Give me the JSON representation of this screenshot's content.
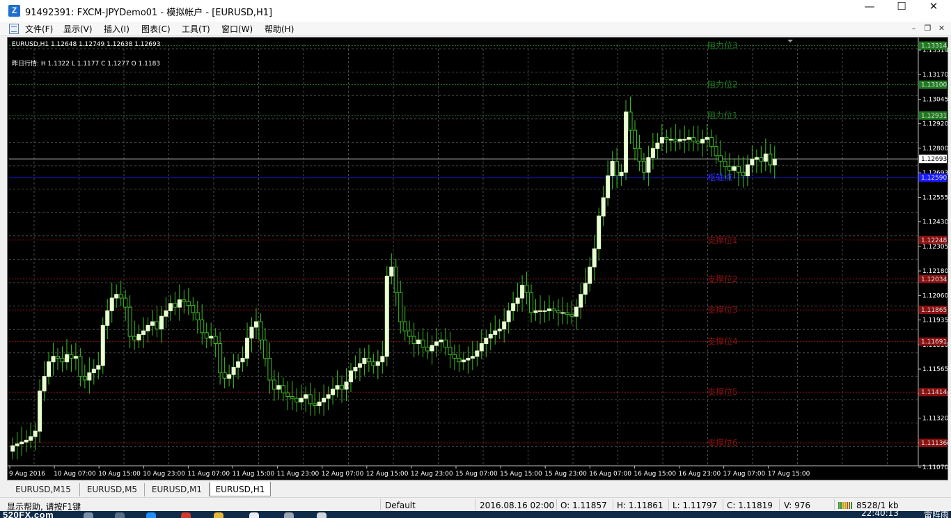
{
  "window": {
    "title": "91492391: FXCM-JPYDemo01 - 模拟帐户 - [EURUSD,H1]",
    "app_icon_letter": "Z",
    "min_glyph": "—",
    "max_glyph": "☐",
    "close_glyph": "✕"
  },
  "menu": {
    "items": [
      {
        "label": "文件(F)"
      },
      {
        "label": "显示(V)"
      },
      {
        "label": "插入(I)"
      },
      {
        "label": "图表(C)"
      },
      {
        "label": "工具(T)"
      },
      {
        "label": "窗口(W)"
      },
      {
        "label": "帮助(H)"
      }
    ],
    "mdi_min": "–",
    "mdi_restore": "❐",
    "mdi_close": "✕"
  },
  "chart": {
    "symbol_header": "EURUSD,H1  1.12648 1.12749 1.12638 1.12693",
    "yesterday_info": "昨日行情:  H 1.1322   L 1.1177   C 1.1277   O 1.1183",
    "colors": {
      "background": "#000000",
      "grid": "#4a4a4a",
      "bull_body": "#e8ffcf",
      "wick": "#3bbf1f",
      "resistance": "#1f7a1f",
      "support": "#8a1010",
      "pivot": "#1a1aff",
      "bid": "#c8c8c8"
    }
  },
  "chart_data": {
    "type": "candlestick",
    "symbol": "EURUSD",
    "timeframe": "H1",
    "ylim": [
      1.1101,
      1.1332
    ],
    "y_ticks": [
      1.1314,
      1.13,
      1.128,
      1.126,
      1.124,
      1.122,
      1.12,
      1.118,
      1.116,
      1.114,
      1.112,
      1.11
    ],
    "y_tick_labels": [
      "1.13314",
      "1.13170",
      "1.13045",
      "1.12920",
      "1.12800",
      "1.12693",
      "1.12555",
      "1.12430",
      "1.12305",
      "1.12180",
      "1.12060",
      "1.11935",
      "1.11810",
      "1.11565",
      "1.11440",
      "1.11320",
      "1.11195",
      "1.11070"
    ],
    "x_tick_labels": [
      "9 Aug 2016",
      "10 Aug 07:00",
      "10 Aug 15:00",
      "10 Aug 23:00",
      "11 Aug 07:00",
      "11 Aug 15:00",
      "11 Aug 23:00",
      "12 Aug 07:00",
      "12 Aug 15:00",
      "12 Aug 23:00",
      "15 Aug 07:00",
      "15 Aug 15:00",
      "15 Aug 23:00",
      "16 Aug 07:00",
      "16 Aug 15:00",
      "16 Aug 23:00",
      "17 Aug 07:00",
      "17 Aug 15:00"
    ],
    "current_price": 1.12693,
    "levels": [
      {
        "name": "阻力位3",
        "value": 1.13314,
        "kind": "resistance",
        "tag": "1.13314"
      },
      {
        "name": "阻力位2",
        "value": 1.131,
        "kind": "resistance",
        "tag": "1.13100"
      },
      {
        "name": "阻力位1",
        "value": 1.12931,
        "kind": "resistance",
        "tag": "1.12931"
      },
      {
        "name": "枢轴点",
        "value": 1.1259,
        "kind": "pivot",
        "tag": "1.12590"
      },
      {
        "name": "支撑位1",
        "value": 1.12248,
        "kind": "support",
        "tag": "1.12248"
      },
      {
        "name": "支撑位2",
        "value": 1.12034,
        "kind": "support",
        "tag": "1.12034"
      },
      {
        "name": "支撑位3",
        "value": 1.11865,
        "kind": "support",
        "tag": "1.11865"
      },
      {
        "name": "支撑位4",
        "value": 1.11691,
        "kind": "support",
        "tag": "1.11691"
      },
      {
        "name": "支撑位5",
        "value": 1.11414,
        "kind": "support",
        "tag": "1.11414"
      },
      {
        "name": "支撑位6",
        "value": 1.11136,
        "kind": "support",
        "tag": "1.11136"
      }
    ],
    "close_series": [
      1.1112,
      1.1113,
      1.1114,
      1.1115,
      1.1117,
      1.112,
      1.1142,
      1.115,
      1.1158,
      1.1161,
      1.116,
      1.1158,
      1.1162,
      1.116,
      1.1161,
      1.115,
      1.1148,
      1.1152,
      1.1154,
      1.1156,
      1.1178,
      1.1186,
      1.1193,
      1.1195,
      1.1193,
      1.1188,
      1.1172,
      1.117,
      1.1173,
      1.1175,
      1.1178,
      1.118,
      1.1176,
      1.1183,
      1.1186,
      1.119,
      1.1188,
      1.1192,
      1.1191,
      1.1189,
      1.1185,
      1.1181,
      1.1174,
      1.1171,
      1.1172,
      1.1168,
      1.1152,
      1.1149,
      1.1151,
      1.1155,
      1.1158,
      1.116,
      1.1171,
      1.1177,
      1.118,
      1.117,
      1.116,
      1.1148,
      1.1143,
      1.1145,
      1.1141,
      1.1139,
      1.1138,
      1.1136,
      1.1138,
      1.114,
      1.1135,
      1.1134,
      1.1136,
      1.1138,
      1.114,
      1.1143,
      1.1145,
      1.1143,
      1.1147,
      1.1153,
      1.1155,
      1.1157,
      1.116,
      1.1158,
      1.1156,
      1.1158,
      1.1161,
      1.1205,
      1.121,
      1.1196,
      1.118,
      1.1175,
      1.1172,
      1.1168,
      1.117,
      1.1166,
      1.1164,
      1.1167,
      1.1169,
      1.117,
      1.1166,
      1.1162,
      1.116,
      1.1158,
      1.1159,
      1.116,
      1.1161,
      1.1164,
      1.1168,
      1.1171,
      1.1173,
      1.1175,
      1.1176,
      1.118,
      1.1186,
      1.119,
      1.1193,
      1.12,
      1.1196,
      1.1185,
      1.1186,
      1.1186,
      1.1186,
      1.1187,
      1.1186,
      1.1185,
      1.1185,
      1.1184,
      1.1183,
      1.1188,
      1.1195,
      1.1201,
      1.121,
      1.122,
      1.1238,
      1.1248,
      1.126,
      1.1268,
      1.126,
      1.1262,
      1.1295,
      1.1285,
      1.1275,
      1.1268,
      1.1262,
      1.127,
      1.1275,
      1.1278,
      1.1281,
      1.128,
      1.128,
      1.1279,
      1.128,
      1.128,
      1.1281,
      1.1279,
      1.1278,
      1.128,
      1.1281,
      1.1276,
      1.1271,
      1.1268,
      1.1265,
      1.1263,
      1.1265,
      1.1262,
      1.126,
      1.1266,
      1.1269,
      1.127,
      1.1268,
      1.1272,
      1.1266,
      1.1269
    ]
  },
  "tabs": [
    {
      "label": "EURUSD,M15"
    },
    {
      "label": "EURUSD,M5"
    },
    {
      "label": "EURUSD,M1"
    },
    {
      "label": "EURUSD,H1",
      "active": true
    }
  ],
  "status": {
    "help": "显示帮助, 请按F1键",
    "profile": "Default",
    "datetime": "2016.08.16 02:00",
    "open": "O: 1.11857",
    "high": "H: 1.11861",
    "low": "L: 1.11797",
    "close": "C: 1.11819",
    "volume": "V: 976",
    "traffic": "8528/1 kb"
  },
  "taskbar": {
    "brand": "520FX.com",
    "clock": "22:40:13",
    "tray_text": "雷阵雨"
  }
}
